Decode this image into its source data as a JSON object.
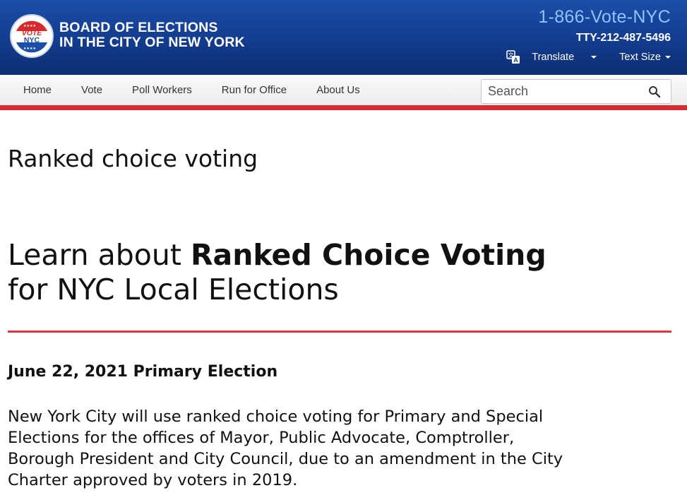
{
  "header": {
    "logo": {
      "badge_top": "VOTE",
      "badge_bottom": "NYC",
      "line1": "BOARD OF ELECTIONS",
      "line2": "IN THE CITY OF NEW YORK"
    },
    "hotline": "1-866-Vote-NYC",
    "tty": "TTY-212-487-5496",
    "translate_label": "Translate",
    "text_size_label": "Text Size",
    "colors": {
      "header_blue": "#143f92",
      "hotline_blue": "#8fc3ff",
      "accent_red": "#d52b2f"
    }
  },
  "nav": {
    "items": [
      {
        "label": "Home"
      },
      {
        "label": "Vote"
      },
      {
        "label": "Poll Workers"
      },
      {
        "label": "Run for Office"
      },
      {
        "label": "About Us"
      }
    ],
    "search": {
      "placeholder": "Search",
      "icon": "search-icon"
    }
  },
  "main": {
    "page_title": "Ranked choice voting",
    "hero": {
      "prefix": "Learn about ",
      "bold": "Ranked Choice Voting",
      "line2": "for NYC Local Elections"
    },
    "section_heading": "June 22, 2021 Primary Election",
    "body": "New York City will use ranked choice voting for Primary and Special Elections for the offices of Mayor, Public Advocate, Comptroller, Borough President and City Council, due to an amendment in the City Charter approved by voters in 2019."
  }
}
